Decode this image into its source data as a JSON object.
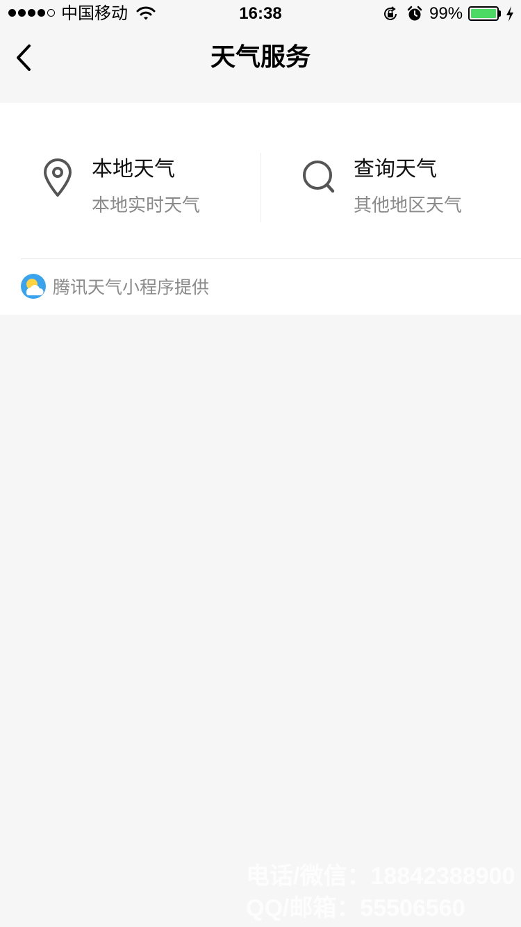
{
  "status_bar": {
    "carrier": "中国移动",
    "time": "16:38",
    "battery_percent": "99%",
    "battery_level": 0.99,
    "battery_color": "#4cd964",
    "signal_bars_filled": 4,
    "signal_bars_total": 5,
    "icons": [
      "wifi-icon",
      "rotation-lock-icon",
      "alarm-icon",
      "charging-bolt-icon"
    ]
  },
  "nav": {
    "title": "天气服务",
    "back_icon": "chevron-left-icon"
  },
  "options": [
    {
      "icon": "location-pin-icon",
      "title": "本地天气",
      "subtitle": "本地实时天气"
    },
    {
      "icon": "search-icon",
      "title": "查询天气",
      "subtitle": "其他地区天气"
    }
  ],
  "provider": {
    "icon": "weather-logo-icon",
    "text": "腾讯天气小程序提供"
  },
  "watermark": {
    "line1": "电话/微信：18842388900",
    "line2": "QQ/邮箱：55506560"
  },
  "colors": {
    "background": "#f6f6f6",
    "card": "#ffffff",
    "secondary_text": "#8a8a8a"
  }
}
